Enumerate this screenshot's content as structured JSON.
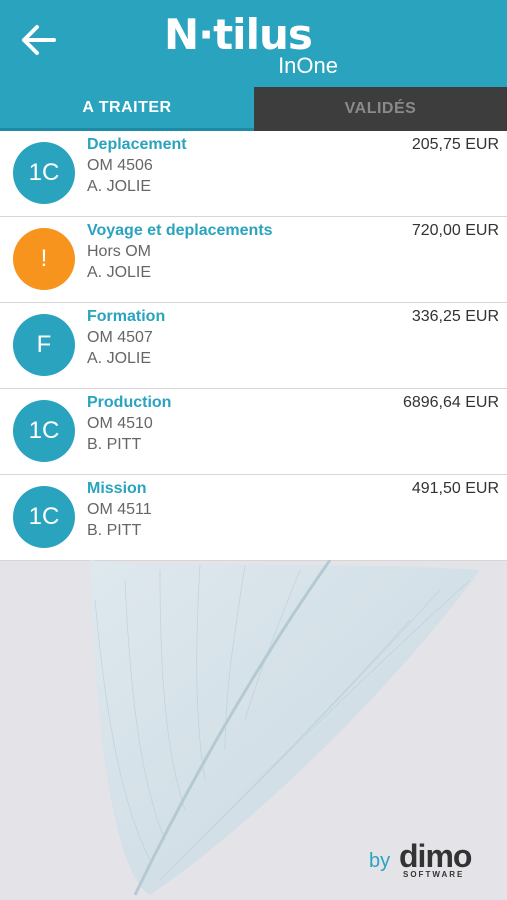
{
  "header": {
    "back_icon": "arrow-left-icon",
    "logo_main": "N·tilus",
    "logo_sub": "InOne"
  },
  "tabs": [
    {
      "label": "A TRAITER",
      "active": true
    },
    {
      "label": "VALIDÉS",
      "active": false
    }
  ],
  "items": [
    {
      "avatar": "1C",
      "avatar_color": "#2aa3bf",
      "title": "Deplacement",
      "line2": "OM 4506",
      "line3": "A. JOLIE",
      "amount": "205,75 EUR"
    },
    {
      "avatar": "!",
      "avatar_color": "#f7941d",
      "title": "Voyage et deplacements",
      "line2": "Hors OM",
      "line3": "A. JOLIE",
      "amount": "720,00 EUR"
    },
    {
      "avatar": "F",
      "avatar_color": "#2aa3bf",
      "title": "Formation",
      "line2": "OM 4507",
      "line3": "A. JOLIE",
      "amount": "336,25 EUR"
    },
    {
      "avatar": "1C",
      "avatar_color": "#2aa3bf",
      "title": "Production",
      "line2": "OM 4510",
      "line3": "B. PITT",
      "amount": "6896,64 EUR"
    },
    {
      "avatar": "1C",
      "avatar_color": "#2aa3bf",
      "title": "Mission",
      "line2": "OM 4511",
      "line3": "B. PITT",
      "amount": "491,50 EUR"
    }
  ],
  "footer": {
    "by": "by",
    "brand": "dimo",
    "brand_sub": "SOFTWARE"
  },
  "colors": {
    "accent": "#2aa3bf",
    "warning": "#f7941d",
    "tab_inactive_bg": "#3d3d3d"
  }
}
